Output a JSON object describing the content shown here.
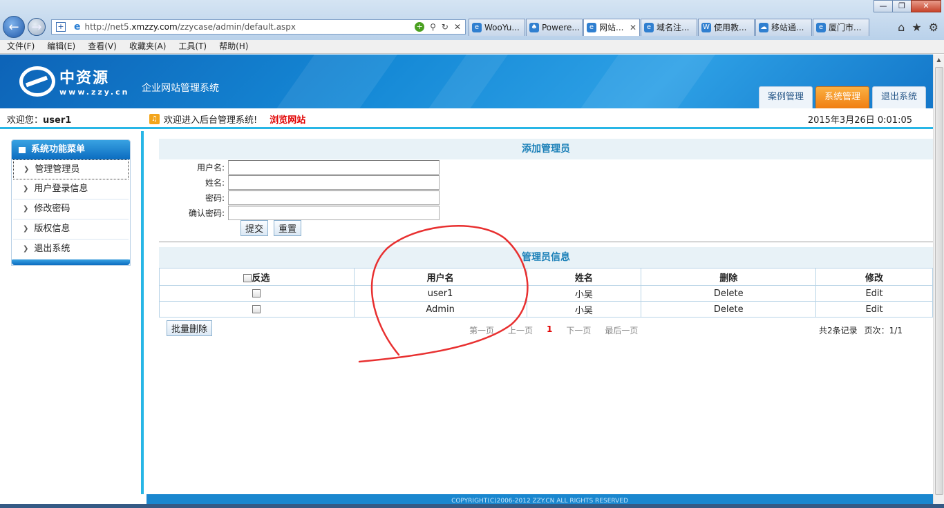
{
  "browser": {
    "address": {
      "prefix": "http://net5.",
      "host": "xmzzy.com",
      "path": "/zzycase/admin/default.aspx"
    },
    "tabs": [
      {
        "label": "WooYu..."
      },
      {
        "label": "Powere..."
      },
      {
        "label": "网站..."
      },
      {
        "label": "域名注..."
      },
      {
        "label": "使用教..."
      },
      {
        "label": "移站通..."
      },
      {
        "label": "厦门市..."
      }
    ],
    "menu": [
      "文件(F)",
      "编辑(E)",
      "查看(V)",
      "收藏夹(A)",
      "工具(T)",
      "帮助(H)"
    ]
  },
  "header": {
    "logo_cn": "中资源",
    "logo_en": "www.zzy.cn",
    "system_title": "企业网站管理系统",
    "nav": [
      {
        "label": "案例管理",
        "active": false
      },
      {
        "label": "系统管理",
        "active": true
      },
      {
        "label": "退出系统",
        "active": false
      }
    ]
  },
  "welcome": {
    "prefix": "欢迎您：",
    "username": "user1",
    "message": "欢迎进入后台管理系统!",
    "browse_link": "浏览网站",
    "datetime": "2015年3月26日 0:01:05"
  },
  "sidebar": {
    "title": "系统功能菜单",
    "items": [
      {
        "label": "管理管理员"
      },
      {
        "label": "用户登录信息"
      },
      {
        "label": "修改密码"
      },
      {
        "label": "版权信息"
      },
      {
        "label": "退出系统"
      }
    ]
  },
  "add_form": {
    "title": "添加管理员",
    "fields": [
      {
        "label": "用户名:",
        "value": ""
      },
      {
        "label": "姓名:",
        "value": ""
      },
      {
        "label": "密码:",
        "value": ""
      },
      {
        "label": "确认密码:",
        "value": ""
      }
    ],
    "submit_label": "提交",
    "reset_label": "重置"
  },
  "admin_table": {
    "title": "管理员信息",
    "columns": [
      "反选",
      "用户名",
      "姓名",
      "删除",
      "修改"
    ],
    "rows": [
      {
        "username": "user1",
        "name": "小吴",
        "delete": "Delete",
        "edit": "Edit"
      },
      {
        "username": "Admin",
        "name": "小吴",
        "delete": "Delete",
        "edit": "Edit"
      }
    ],
    "batch_delete_label": "批量删除",
    "pager": {
      "first": "第一页",
      "prev": "上一页",
      "current": "1",
      "next": "下一页",
      "last": "最后一页",
      "total": "共2条记录",
      "pages": "页次：1/1"
    }
  },
  "footer": {
    "copyright": "COPYRIGHT(C)2006-2012 ZZY.CN ALL RIGHTS RESERVED"
  },
  "colors": {
    "accent": "#28b6e6",
    "header_blue": "#1589d6",
    "active_tab": "#f07e12",
    "annotation": "#e83030"
  }
}
